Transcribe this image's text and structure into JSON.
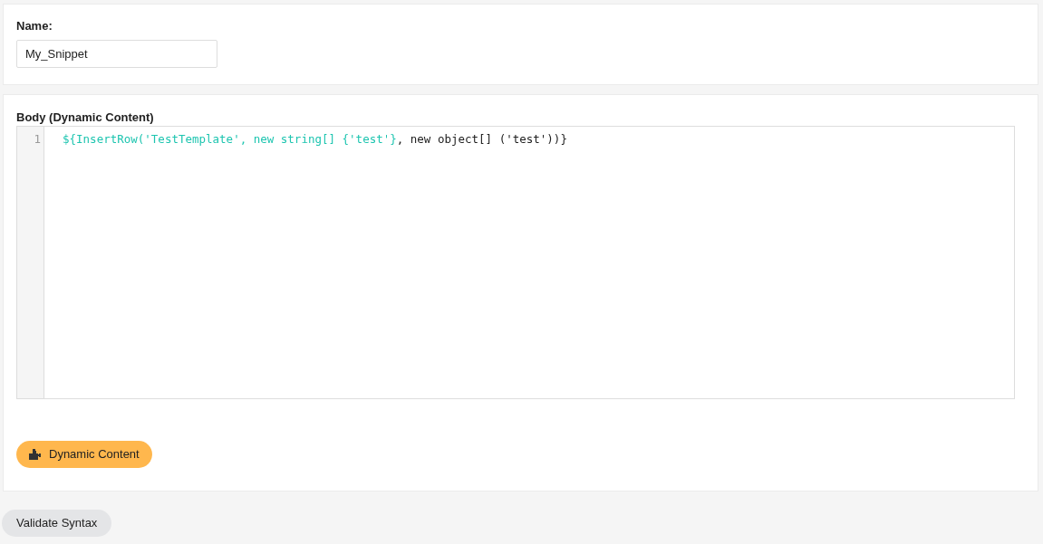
{
  "name_section": {
    "label": "Name:",
    "value": "My_Snippet"
  },
  "body_section": {
    "label": "Body (Dynamic Content)",
    "editor": {
      "lines": [
        {
          "number": "1",
          "tokens": [
            {
              "kind": "highlighted",
              "text": "${InsertRow('TestTemplate', new string[] {'test'}"
            },
            {
              "kind": "plain",
              "text": ", new object[] ('test'))}"
            }
          ]
        }
      ]
    },
    "dynamic_content_button": "Dynamic Content"
  },
  "validate_button": "Validate Syntax"
}
